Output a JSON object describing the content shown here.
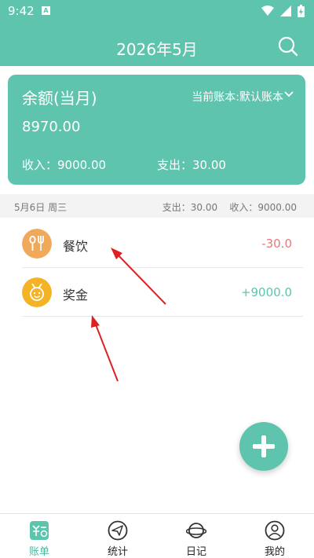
{
  "status": {
    "time": "9:42",
    "badge": "A"
  },
  "header": {
    "title": "2026年5月"
  },
  "card": {
    "balance_title": "余额(当月)",
    "account": "当前账本:默认账本",
    "balance": "8970.00",
    "income": "收入：9000.00",
    "expense": "支出：30.00"
  },
  "day": {
    "date": "5月6日 周三",
    "summary": "支出：30.00    收入：9000.00"
  },
  "records": [
    {
      "category": "餐饮",
      "amount": "-30.0",
      "icon": "fork-spoon-icon",
      "icon_color": "#f0a95a",
      "amount_color": "#e67a7a"
    },
    {
      "category": "奖金",
      "amount": "+9000.0",
      "icon": "medal-icon",
      "icon_color": "#f3b325",
      "amount_color": "#5ec4ae"
    }
  ],
  "tabs": [
    {
      "label": "账单",
      "icon": "bill-icon",
      "active": true
    },
    {
      "label": "统计",
      "icon": "paper-plane-icon",
      "active": false
    },
    {
      "label": "日记",
      "icon": "planet-icon",
      "active": false
    },
    {
      "label": "我的",
      "icon": "user-icon",
      "active": false
    }
  ],
  "colors": {
    "primary": "#5ec4ae",
    "expense": "#e67a7a",
    "annotation_arrow": "#e02020"
  }
}
